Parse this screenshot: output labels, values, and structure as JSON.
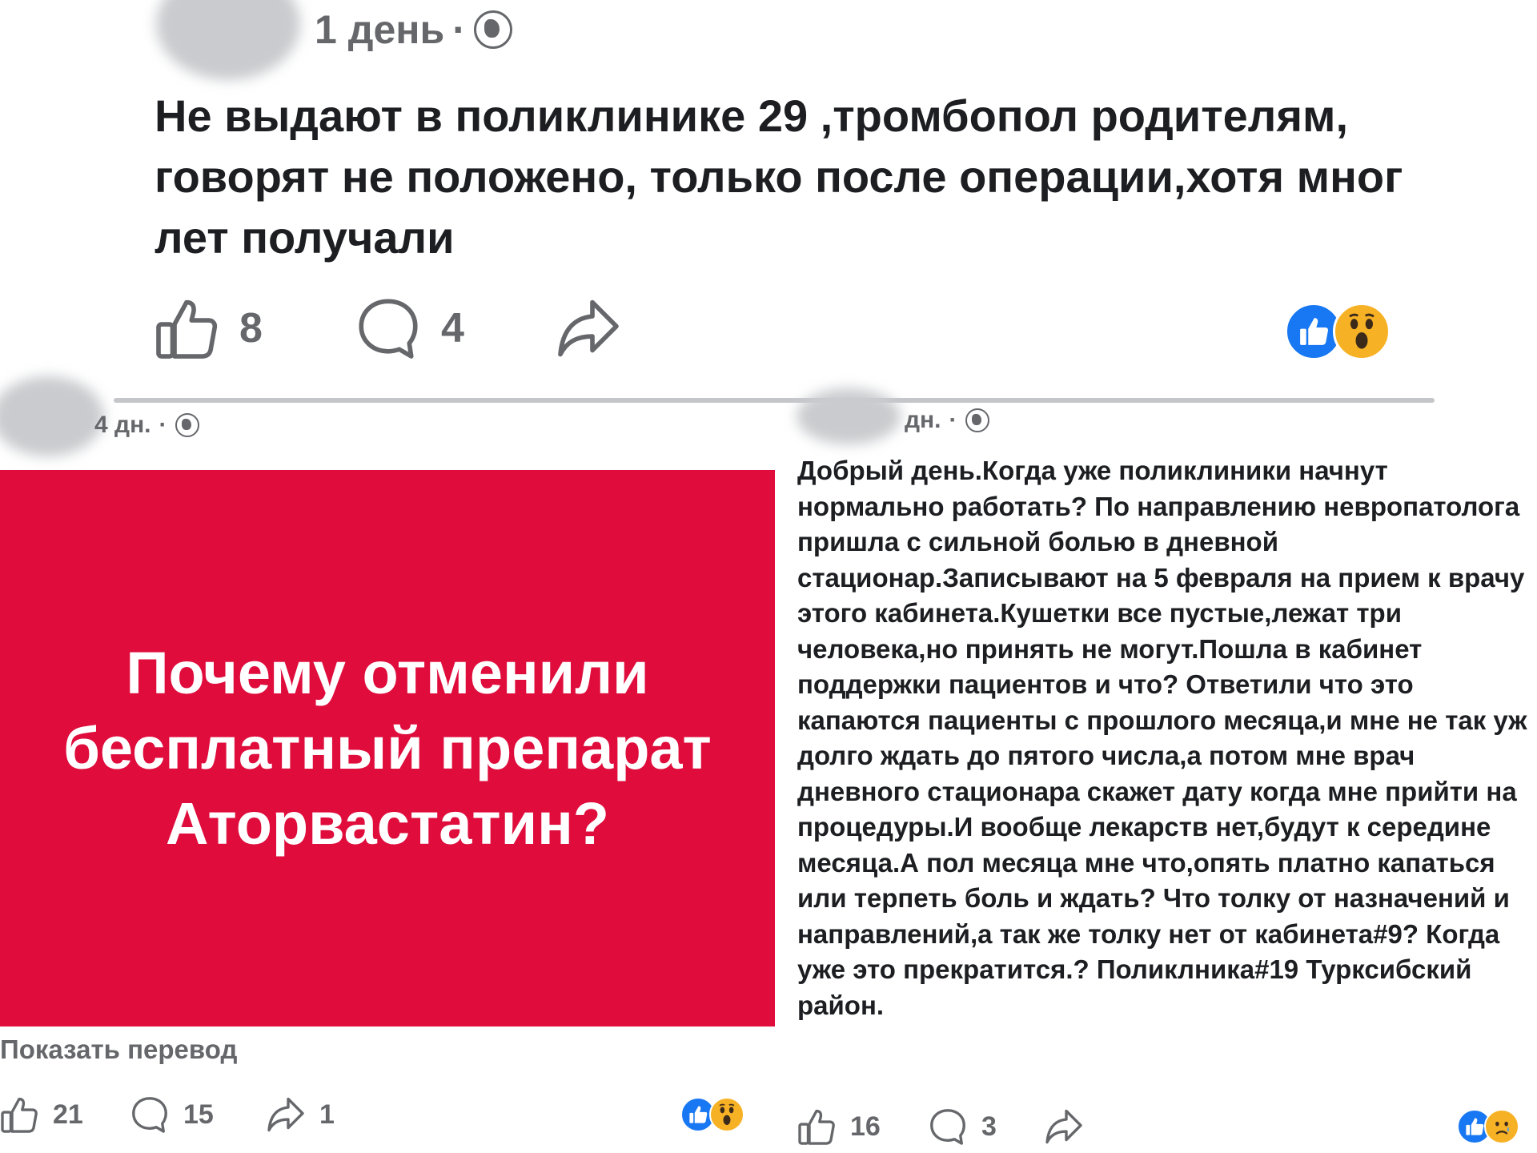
{
  "top_post": {
    "time": "1 день",
    "separator": "·",
    "text": "Не выдают в поликлинике 29 ,тромбопол родителям, говорят не положено, только после операции,хотя мног лет получали",
    "likes": "8",
    "comments": "4"
  },
  "left_post": {
    "time": "4 дн.",
    "separator": "·",
    "image_text": "Почему отменили бесплатный препарат Аторвастатин?",
    "show_translation": "Показать перевод",
    "likes": "21",
    "comments": "15",
    "shares": "1"
  },
  "right_post": {
    "time": "дн.",
    "separator": "·",
    "text": "Добрый день.Когда уже поликлиники начнут нормально работать? По направлению невропатолога пришла с сильной болью в дневной стационар.Записывают на 5 февраля на прием к врачу этого кабинета.Кушетки все пустые,лежат три человека,но принять не могут.Пошла в кабинет поддержки пациентов и что? Ответили что это капаются пациенты с прошлого месяца,и мне не так уж долго ждать до пятого числа,а потом мне врач дневного стационара скажет дату когда мне прийти на процедуры.И вообще лекарств нет,будут к середине месяца.А пол месяца мне что,опять платно  капаться или терпеть боль и ждать? Что толку от назначений и направлений,а так же толку нет от кабинета#9? Когда уже это прекратится.? Поликлника#19 Турксибский район.",
    "likes": "16",
    "comments": "3"
  },
  "icons": {
    "like": "thumbs-up-icon",
    "comment": "comment-bubble-icon",
    "share": "share-arrow-icon",
    "privacy": "globe-icon",
    "reaction_like": "like-reaction-icon",
    "reaction_wow": "wow-reaction-icon",
    "reaction_sad": "sad-reaction-icon"
  },
  "colors": {
    "image_background": "#df0c3c",
    "meta_text": "#65676b",
    "like_blue": "#1877f2",
    "emoji_yellow": "#f7b125"
  }
}
